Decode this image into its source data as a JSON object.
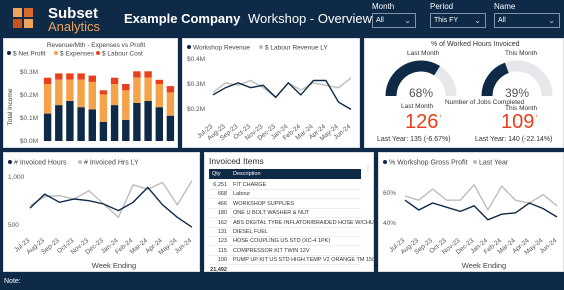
{
  "header": {
    "brand_title": "Subset",
    "brand_sub": "Analytics",
    "company": "Example Company",
    "page_title": "Workshop - Overview",
    "slicers": [
      {
        "label": "Month",
        "value": "All"
      },
      {
        "label": "Period",
        "value": "This FY"
      },
      {
        "label": "Name",
        "value": "All"
      }
    ],
    "accent": "#f0a35a"
  },
  "footer": {
    "note": "Note:"
  },
  "profit_chart": {
    "title": "Revenue/Mth - Expenses vs Profit",
    "legend": [
      {
        "name": "$ Net Profit",
        "color": "#0e2a47"
      },
      {
        "name": "$ Expenses",
        "color": "#f5a34a"
      },
      {
        "name": "$ Labour Cost",
        "color": "#e8401c"
      }
    ],
    "ylabel": "Total Income",
    "yticks": [
      "$0.3M",
      "$0.2M",
      "$0.1M",
      "$0.0M"
    ]
  },
  "revenue_chart": {
    "legend": [
      {
        "name": "Workshop Revenue",
        "color": "#0e2a47"
      },
      {
        "name": "$ Labour Revenue LY",
        "color": "#bdbdbd"
      }
    ],
    "yticks": [
      "$0.4M",
      "$0.3M",
      "$0.2M"
    ]
  },
  "kpis": {
    "worked_title": "% of Worked Hours Invoiced",
    "last_month": "Last Month",
    "this_month": "This Month",
    "last_pct": "68%",
    "this_pct": "39%",
    "jobs_title": "Number of Jobs Completed",
    "jobs_last": "126",
    "jobs_this": "109",
    "jobs_last_sub": "Last Year: 135 (-6.67%)",
    "jobs_this_sub": "Last Year: 140 (-22.14%)"
  },
  "hours_chart": {
    "legend": [
      {
        "name": "# Invoiced Hours",
        "color": "#0e2a47"
      },
      {
        "name": "# Invoiced Hrs LY",
        "color": "#bdbdbd"
      }
    ],
    "yticks": [
      "1,000",
      "500"
    ],
    "xlabel": "Week Ending"
  },
  "invoiced_items": {
    "title": "Invoiced Items",
    "col_qty": "Qty",
    "col_desc": "Description",
    "rows": [
      {
        "qty": "6,251",
        "desc": "FIT CHARGE"
      },
      {
        "qty": "668",
        "desc": "Labour"
      },
      {
        "qty": "466",
        "desc": "WORKSHOP SUPPLIES"
      },
      {
        "qty": "180",
        "desc": "ONE U BOLT WASHER & NUT"
      },
      {
        "qty": "162",
        "desc": "ABS DIGITAL TYRE INFLATOR/BRAIDED HOSE W/CHUCK"
      },
      {
        "qty": "131",
        "desc": "DIESEL FUEL"
      },
      {
        "qty": "123",
        "desc": "HOSE COUPLING US STD (XC-4 1PK)"
      },
      {
        "qty": "115",
        "desc": "COMPRESSOR KIT TWIN 12V"
      },
      {
        "qty": "100",
        "desc": "PUMP UP KIT US STD HIGH TEMP V2 ORANGE TM 150 PSI"
      }
    ],
    "total": "21,492"
  },
  "gross_profit_chart": {
    "legend": [
      {
        "name": "% Workshop Gross Profit",
        "color": "#0e2a47"
      },
      {
        "name": "Last Year",
        "color": "#bdbdbd"
      }
    ],
    "yticks": [
      "60%",
      "40%"
    ],
    "xlabel": "Week Ending"
  },
  "months": [
    "Jul-23",
    "Aug-23",
    "Sep-23",
    "Oct-23",
    "Nov-23",
    "Dec-23",
    "Jan-24",
    "Feb-24",
    "Mar-24",
    "Apr-24",
    "May-24",
    "Jun-24"
  ],
  "chart_data": [
    {
      "type": "bar",
      "title": "Revenue/Mth - Expenses vs Profit",
      "ylabel": "Total Income",
      "categories": [
        "Jul-23",
        "Aug-23",
        "Sep-23",
        "Oct-23",
        "Nov-23",
        "Dec-23",
        "Jan-24",
        "Feb-24",
        "Mar-24",
        "Apr-24",
        "May-24",
        "Jun-24"
      ],
      "stacked": true,
      "ylim": [
        0,
        0.36
      ],
      "series": [
        {
          "name": "$ Net Profit",
          "values": [
            0.13,
            0.17,
            0.19,
            0.16,
            0.15,
            0.09,
            0.17,
            0.1,
            0.18,
            0.19,
            0.16,
            0.12
          ]
        },
        {
          "name": "$ Expenses",
          "values": [
            0.14,
            0.12,
            0.1,
            0.13,
            0.13,
            0.13,
            0.1,
            0.14,
            0.12,
            0.11,
            0.11,
            0.11
          ]
        },
        {
          "name": "$ Labour Cost",
          "values": [
            0.03,
            0.03,
            0.03,
            0.03,
            0.03,
            0.02,
            0.03,
            0.03,
            0.03,
            0.03,
            0.02,
            0.03
          ]
        }
      ]
    },
    {
      "type": "line",
      "x": [
        "Jul-23",
        "Aug-23",
        "Sep-23",
        "Oct-23",
        "Nov-23",
        "Dec-23",
        "Jan-24",
        "Feb-24",
        "Mar-24",
        "Apr-24",
        "May-24",
        "Jun-24"
      ],
      "ylim": [
        0.15,
        0.42
      ],
      "series": [
        {
          "name": "Workshop Revenue",
          "values": [
            0.25,
            0.28,
            0.3,
            0.28,
            0.29,
            0.24,
            0.3,
            0.25,
            0.31,
            0.31,
            0.22,
            0.19
          ]
        },
        {
          "name": "$ Labour Revenue LY",
          "values": [
            0.26,
            0.3,
            0.29,
            0.31,
            0.28,
            0.24,
            0.3,
            0.27,
            0.3,
            0.29,
            0.28,
            0.32
          ]
        }
      ]
    },
    {
      "type": "line",
      "xlabel": "Week Ending",
      "x": [
        "Jul-23",
        "Aug-23",
        "Sep-23",
        "Oct-23",
        "Nov-23",
        "Dec-23",
        "Jan-24",
        "Feb-24",
        "Mar-24",
        "Apr-24",
        "May-24",
        "Jun-24"
      ],
      "ylim": [
        350,
        1050
      ],
      "series": [
        {
          "name": "# Invoiced Hours",
          "values": [
            650,
            820,
            720,
            760,
            740,
            700,
            620,
            720,
            900,
            690,
            540,
            420
          ]
        },
        {
          "name": "# Invoiced Hrs LY",
          "values": [
            680,
            790,
            800,
            760,
            860,
            700,
            540,
            930,
            880,
            960,
            690,
            980
          ]
        }
      ]
    },
    {
      "type": "line",
      "xlabel": "Week Ending",
      "x": [
        "Jul-23",
        "Aug-23",
        "Sep-23",
        "Oct-23",
        "Nov-23",
        "Dec-23",
        "Jan-24",
        "Feb-24",
        "Mar-24",
        "Apr-24",
        "May-24",
        "Jun-24"
      ],
      "ylim": [
        30,
        70
      ],
      "series": [
        {
          "name": "% Workshop Gross Profit",
          "values": [
            52,
            45,
            50,
            47,
            44,
            48,
            38,
            42,
            43,
            50,
            46,
            40
          ]
        },
        {
          "name": "Last Year",
          "values": [
            55,
            52,
            60,
            52,
            52,
            63,
            45,
            62,
            52,
            50,
            56,
            48
          ]
        }
      ]
    }
  ]
}
